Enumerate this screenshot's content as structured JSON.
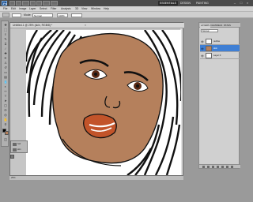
{
  "app": {
    "logo": "Ps",
    "workspaces": [
      "ESSENTIALS",
      "DESIGN",
      "PAINTING"
    ],
    "window_controls": [
      "–",
      "□",
      "×"
    ]
  },
  "menu": [
    "File",
    "Edit",
    "Image",
    "Layer",
    "Select",
    "Filter",
    "Analysis",
    "3D",
    "View",
    "Window",
    "Help"
  ],
  "options": {
    "mode_label": "Mode:",
    "mode_value": "Normal",
    "opacity_value": "100%"
  },
  "document": {
    "tab_label": "Untitled-1 @ 25% (skin, RGB/8) *",
    "close": "×",
    "status": "25%"
  },
  "mini_panel": {
    "rows": [
      "hair",
      "skin"
    ]
  },
  "layers_panel": {
    "tabs": [
      "LAYERS",
      "CHANNELS",
      "PATHS"
    ],
    "blend_mode": "Normal",
    "layers": [
      {
        "name": "outline",
        "active": false
      },
      {
        "name": "skin",
        "active": true
      },
      {
        "name": "Layer 0",
        "active": false
      }
    ]
  },
  "colors": {
    "skin": "#b5805c",
    "lips": "#c2542a",
    "accent": "#3f7fd4",
    "foreground_swatch": "#000000",
    "background_swatch": "#b5805c"
  }
}
